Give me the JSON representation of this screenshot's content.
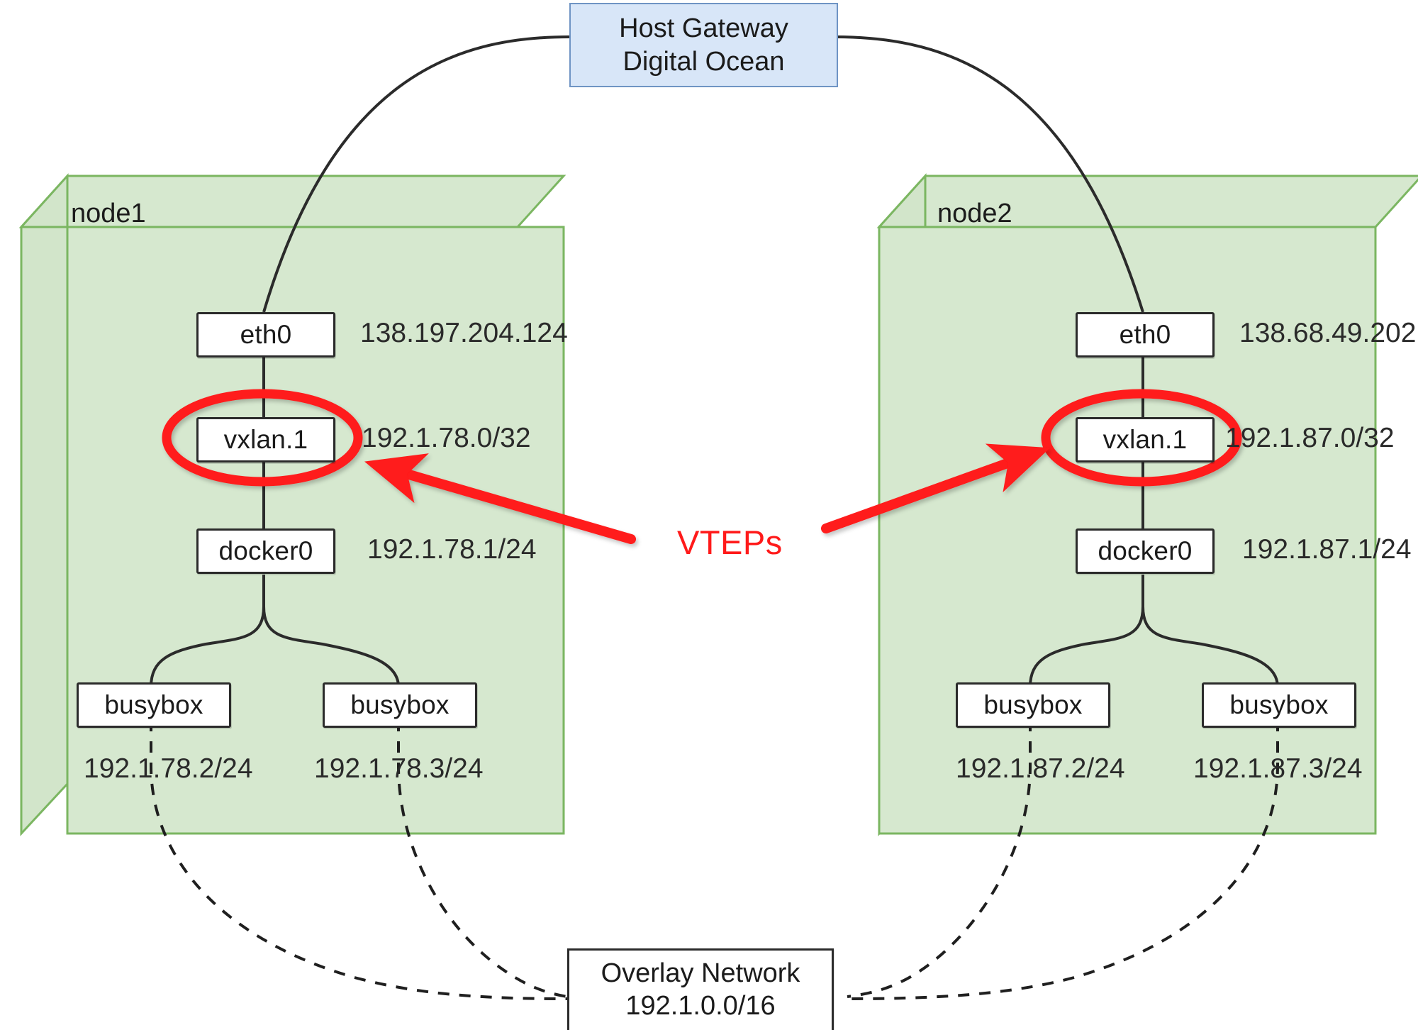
{
  "diagram": {
    "title": "Docker VXLAN overlay network topology",
    "colors": {
      "node_fill": "#d6e8cf",
      "node_stroke": "#7bb661",
      "gateway_fill": "#d8e6f8",
      "gateway_stroke": "#6f94c4",
      "highlight": "#ff1a1a",
      "line": "#2b2b2b"
    }
  },
  "gateway": {
    "line1": "Host Gateway",
    "line2": "Digital Ocean"
  },
  "annotation": {
    "vteps_label": "VTEPs"
  },
  "overlay": {
    "line1": "Overlay Network",
    "line2": "192.1.0.0/16"
  },
  "nodes": [
    {
      "name": "node1",
      "interfaces": [
        {
          "label": "eth0",
          "ip": "138.197.204.124"
        },
        {
          "label": "vxlan.1",
          "ip": "192.1.78.0/32",
          "highlighted": true
        },
        {
          "label": "docker0",
          "ip": "192.1.78.1/24"
        }
      ],
      "containers": [
        {
          "label": "busybox",
          "ip": "192.1.78.2/24"
        },
        {
          "label": "busybox",
          "ip": "192.1.78.3/24"
        }
      ]
    },
    {
      "name": "node2",
      "interfaces": [
        {
          "label": "eth0",
          "ip": "138.68.49.202"
        },
        {
          "label": "vxlan.1",
          "ip": "192.1.87.0/32",
          "highlighted": true
        },
        {
          "label": "docker0",
          "ip": "192.1.87.1/24"
        }
      ],
      "containers": [
        {
          "label": "busybox",
          "ip": "192.1.87.2/24"
        },
        {
          "label": "busybox",
          "ip": "192.1.87.3/24"
        }
      ]
    }
  ]
}
